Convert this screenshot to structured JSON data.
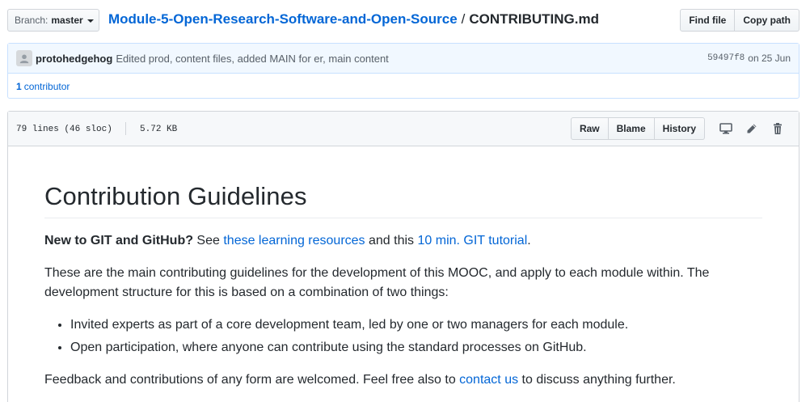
{
  "topbar": {
    "branch_prefix": "Branch:",
    "branch_name": "master",
    "repo_link": "Module-5-Open-Research-Software-and-Open-Source",
    "separator": "/",
    "file_name": "CONTRIBUTING.md",
    "find_file_label": "Find file",
    "copy_path_label": "Copy path"
  },
  "commit": {
    "author": "protohedgehog",
    "message": "Edited prod, content files, added MAIN for er, main content",
    "sha": "59497f8",
    "date": "on 25 Jun",
    "contributors_count": "1",
    "contributors_label": "contributor"
  },
  "file": {
    "lines_info": "79 lines (46 sloc)",
    "size": "5.72 KB",
    "raw_label": "Raw",
    "blame_label": "Blame",
    "history_label": "History",
    "icons": [
      "desktop-icon",
      "pencil-icon",
      "trash-icon"
    ]
  },
  "content": {
    "heading": "Contribution Guidelines",
    "p1_bold": "New to GIT and GitHub?",
    "p1_text1": " See ",
    "p1_link1": "these learning resources",
    "p1_text2": " and this ",
    "p1_link2": "10 min. GIT tutorial",
    "p1_text3": ".",
    "p2": "These are the main contributing guidelines for the development of this MOOC, and apply to each module within. The development structure for this is based on a combination of two things:",
    "bullets": [
      "Invited experts as part of a core development team, led by one or two managers for each module.",
      "Open participation, where anyone can contribute using the standard processes on GitHub."
    ],
    "p3_text1": "Feedback and contributions of any form are welcomed. Feel free also to ",
    "p3_link": "contact us",
    "p3_text2": " to discuss anything further."
  },
  "colors": {
    "link": "#0366d6",
    "commit_bg": "#f1f8ff",
    "commit_border": "#c8e1ff"
  }
}
